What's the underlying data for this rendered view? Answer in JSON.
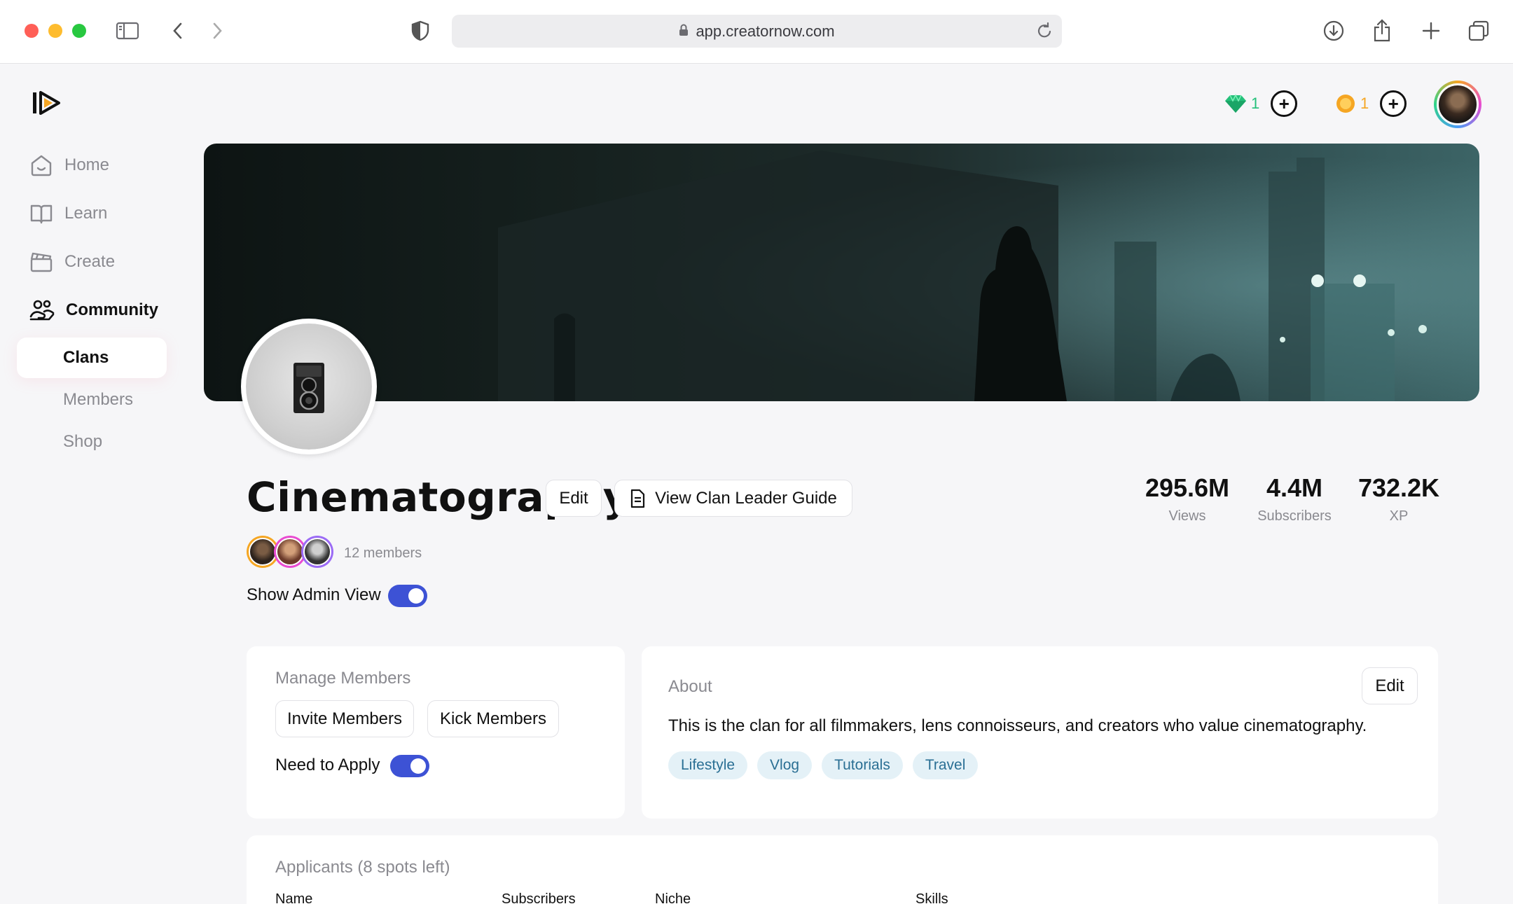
{
  "browser": {
    "url": "app.creatornow.com"
  },
  "sidebar": {
    "items": [
      {
        "label": "Home",
        "icon": "home-icon"
      },
      {
        "label": "Learn",
        "icon": "book-icon"
      },
      {
        "label": "Create",
        "icon": "clapperboard-icon"
      },
      {
        "label": "Community",
        "icon": "community-icon"
      }
    ],
    "subitems": [
      {
        "label": "Clans",
        "active": true
      },
      {
        "label": "Members"
      },
      {
        "label": "Shop"
      }
    ]
  },
  "header": {
    "gems": "1",
    "coins": "1",
    "gem_color": "#24c07a",
    "coin_color": "#f5a623"
  },
  "clan": {
    "name": "Cinematography",
    "edit_label": "Edit",
    "guide_label": "View Clan Leader Guide",
    "members_count": "12 members",
    "admin_view_label": "Show Admin View",
    "admin_view_on": true,
    "stats": [
      {
        "value": "295.6M",
        "label": "Views"
      },
      {
        "value": "4.4M",
        "label": "Subscribers"
      },
      {
        "value": "732.2K",
        "label": "XP"
      }
    ]
  },
  "manage": {
    "title": "Manage Members",
    "invite_label": "Invite Members",
    "kick_label": "Kick Members",
    "apply_label": "Need to Apply",
    "apply_on": true
  },
  "about": {
    "title": "About",
    "edit_label": "Edit",
    "text": "This is the clan for all filmmakers, lens connoisseurs, and creators who value cinematography.",
    "tags": [
      "Lifestyle",
      "Vlog",
      "Tutorials",
      "Travel"
    ]
  },
  "applicants": {
    "title": "Applicants (8 spots left)",
    "columns": [
      "Name",
      "Subscribers",
      "Niche",
      "Skills"
    ]
  },
  "accent_color": "#3d52d5"
}
